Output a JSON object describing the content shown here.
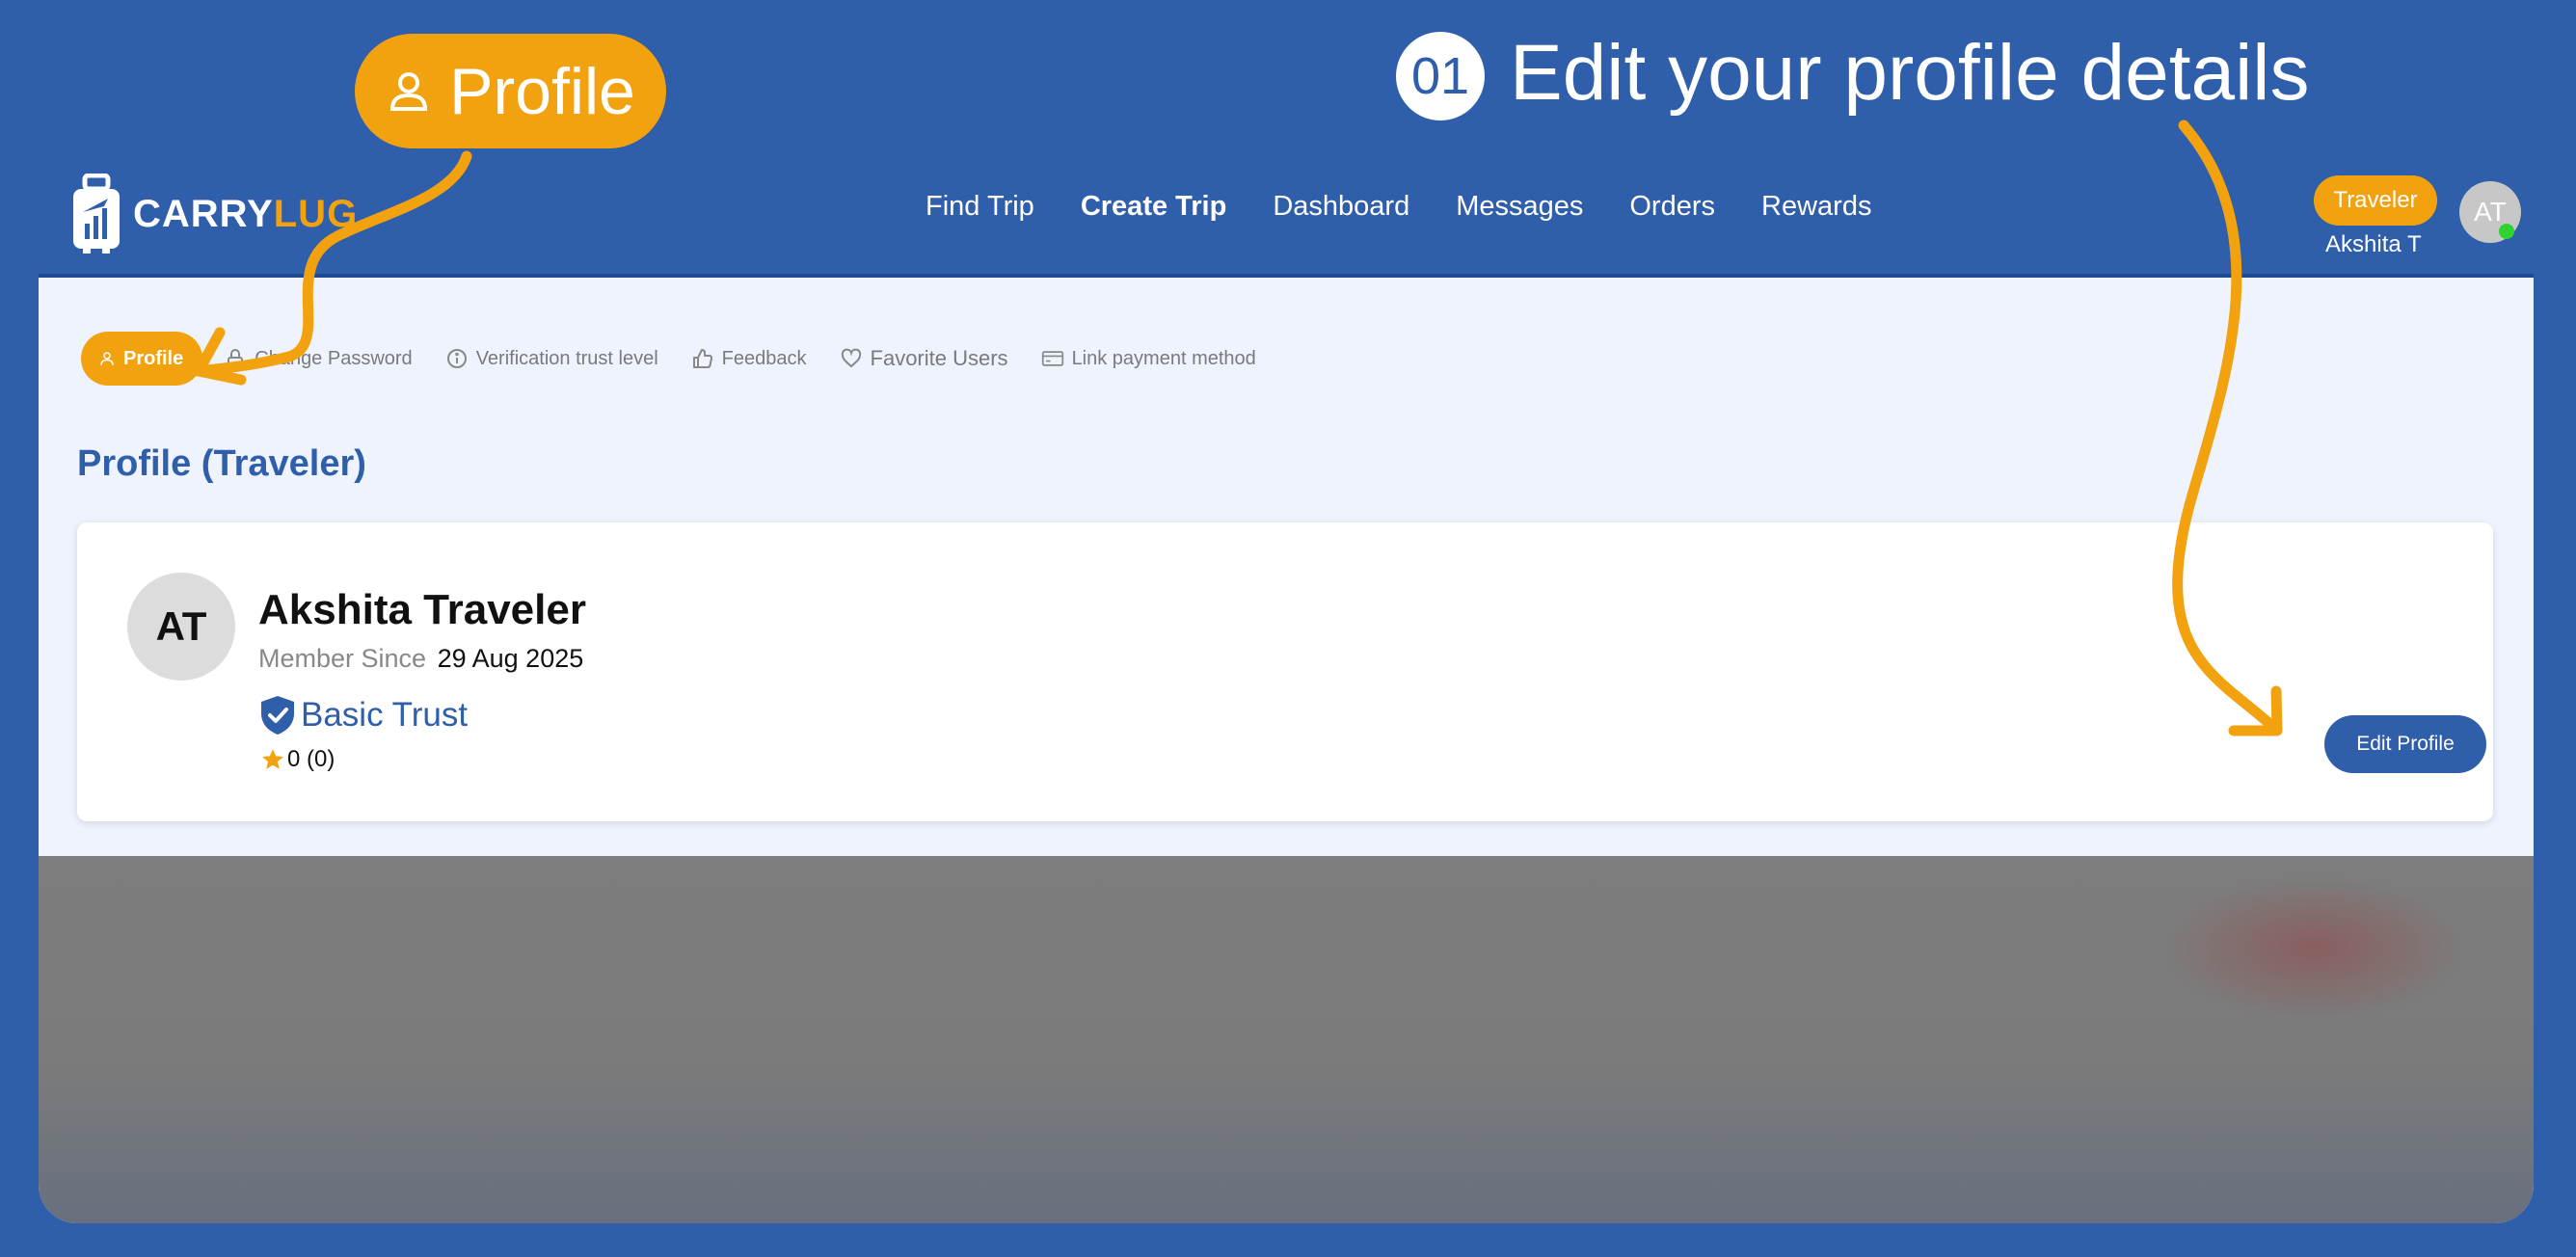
{
  "callout": {
    "pill_label": "Profile",
    "step_number": "01",
    "step_title": "Edit your profile details"
  },
  "colors": {
    "brand_blue": "#2f5eab",
    "accent_orange": "#f3a20f",
    "page_bg": "#eef3fd"
  },
  "logo": {
    "text_light": "CARRY",
    "text_accent": "LUG"
  },
  "nav": {
    "links": [
      "Find Trip",
      "Create Trip",
      "Dashboard",
      "Messages",
      "Orders",
      "Rewards"
    ],
    "active": "Create Trip"
  },
  "user": {
    "role": "Traveler",
    "display_name": "Akshita T",
    "initials": "AT",
    "status": "online"
  },
  "tabs": [
    {
      "label": "Profile",
      "icon": "user-icon",
      "active": true
    },
    {
      "label": "Change Password",
      "icon": "lock-icon"
    },
    {
      "label": "Verification trust level",
      "icon": "info-icon"
    },
    {
      "label": "Feedback",
      "icon": "thumbs-up-icon"
    },
    {
      "label": "Favorite Users",
      "icon": "heart-icon"
    },
    {
      "label": "Link payment method",
      "icon": "credit-card-icon"
    }
  ],
  "page": {
    "title": "Profile (Traveler)"
  },
  "profile": {
    "initials": "AT",
    "full_name": "Akshita Traveler",
    "member_label": "Member Since",
    "member_date": "29 Aug 2025",
    "trust_level": "Basic Trust",
    "trust_icon": "shield-check-icon",
    "rating": "0 (0)",
    "rating_icon": "star-icon",
    "edit_button": "Edit Profile"
  }
}
